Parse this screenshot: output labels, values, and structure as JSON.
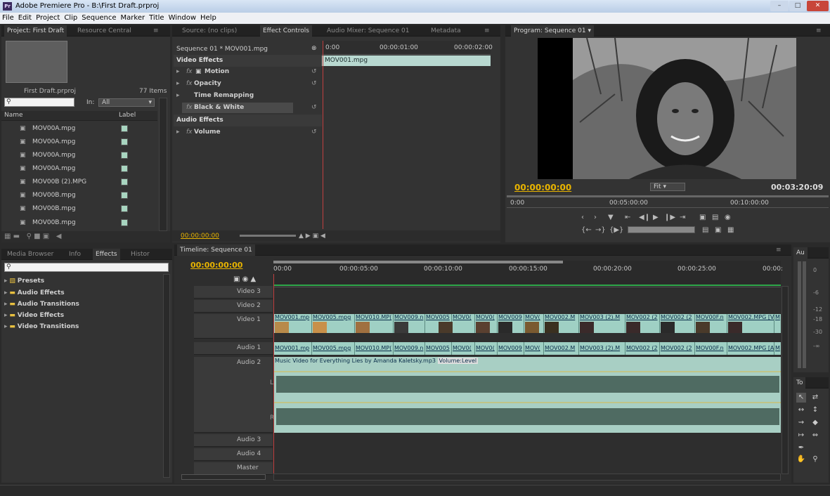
{
  "window": {
    "title": "Adobe Premiere Pro - B:\\First Draft.prproj",
    "app_icon": "Pr"
  },
  "menu": [
    "File",
    "Edit",
    "Project",
    "Clip",
    "Sequence",
    "Marker",
    "Title",
    "Window",
    "Help"
  ],
  "project": {
    "tabs": [
      "Project: First Draft",
      "Resource Central"
    ],
    "name": "First Draft.prproj",
    "count": "77 Items",
    "in_label": "In:",
    "in_value": "All",
    "col_name": "Name",
    "col_label": "Label",
    "items": [
      "MOV00A.mpg",
      "MOV00A.mpg",
      "MOV00A.mpg",
      "MOV00A.mpg",
      "MOV00B (2).MPG",
      "MOV00B.mpg",
      "MOV00B.mpg",
      "MOV00B.mpg"
    ]
  },
  "effect_controls": {
    "tabs": [
      "Source: (no clips)",
      "Effect Controls",
      "Audio Mixer: Sequence 01",
      "Metadata"
    ],
    "sequence": "Sequence 01 * MOV001.mpg",
    "times": [
      "0:00",
      "00:00:01:00",
      "00:00:02:00"
    ],
    "clip": "MOV001.mpg",
    "video_effects": "Video Effects",
    "effects": [
      "Motion",
      "Opacity",
      "Time Remapping",
      "Black & White"
    ],
    "audio_effects": "Audio Effects",
    "audio_items": [
      "Volume"
    ],
    "timecode": "00:00:00:00"
  },
  "program": {
    "tab": "Program: Sequence 01",
    "timecode": "00:00:00:00",
    "fit": "Fit",
    "duration": "00:03:20:09",
    "ruler": [
      "0:00",
      "00:05:00:00",
      "00:10:00:00"
    ]
  },
  "effects_panel": {
    "tabs": [
      "Media Browser",
      "Info",
      "Effects",
      "Histor"
    ],
    "folders": [
      "Presets",
      "Audio Effects",
      "Audio Transitions",
      "Video Effects",
      "Video Transitions"
    ]
  },
  "timeline": {
    "tab": "Timeline: Sequence 01",
    "timecode": "00:00:00:00",
    "ruler": [
      "00:00",
      "00:00:05:00",
      "00:00:10:00",
      "00:00:15:00",
      "00:00:20:00",
      "00:00:25:00",
      "00:00:"
    ],
    "tracks": [
      "Video 3",
      "Video 2",
      "Video 1",
      "Audio 1",
      "Audio 2",
      "Audio 3",
      "Audio 4",
      "Master"
    ],
    "video_clips": [
      "MOV001.mp",
      "MOV005.mpg",
      "MOV010.MP(",
      "MOV009.n",
      "MOV005",
      "MOV0(",
      "MOV0(",
      "MOV009",
      "MOV(",
      "MOV002.M",
      "MOV003 (2).M",
      "MOV002 (2",
      "MOV002 (2",
      "MOV00F.n",
      "MOV002.MPG [V]",
      "M"
    ],
    "audio_clips": [
      "MOV001.mp",
      "MOV005.mpg",
      "MOV010.MP(",
      "MOV009.n",
      "MOV005",
      "MOV0(",
      "MOV0(",
      "MOV009",
      "MOV(",
      "MOV002.M",
      "MOV003 (2).M",
      "MOV002 (2",
      "MOV002 (2",
      "MOV00F.n",
      "MOV002.MPG [A]",
      "M"
    ],
    "music": "Music Video for Everything Lies by Amanda Kaletsky.mp3",
    "volume": "Volume:Level",
    "L": "L",
    "R": "R"
  },
  "audio_meter": {
    "tab": "Au",
    "labels": [
      "0",
      "-6",
      "-12",
      "-18",
      "-30",
      "-∞"
    ]
  },
  "tools": {
    "tab": "To"
  }
}
